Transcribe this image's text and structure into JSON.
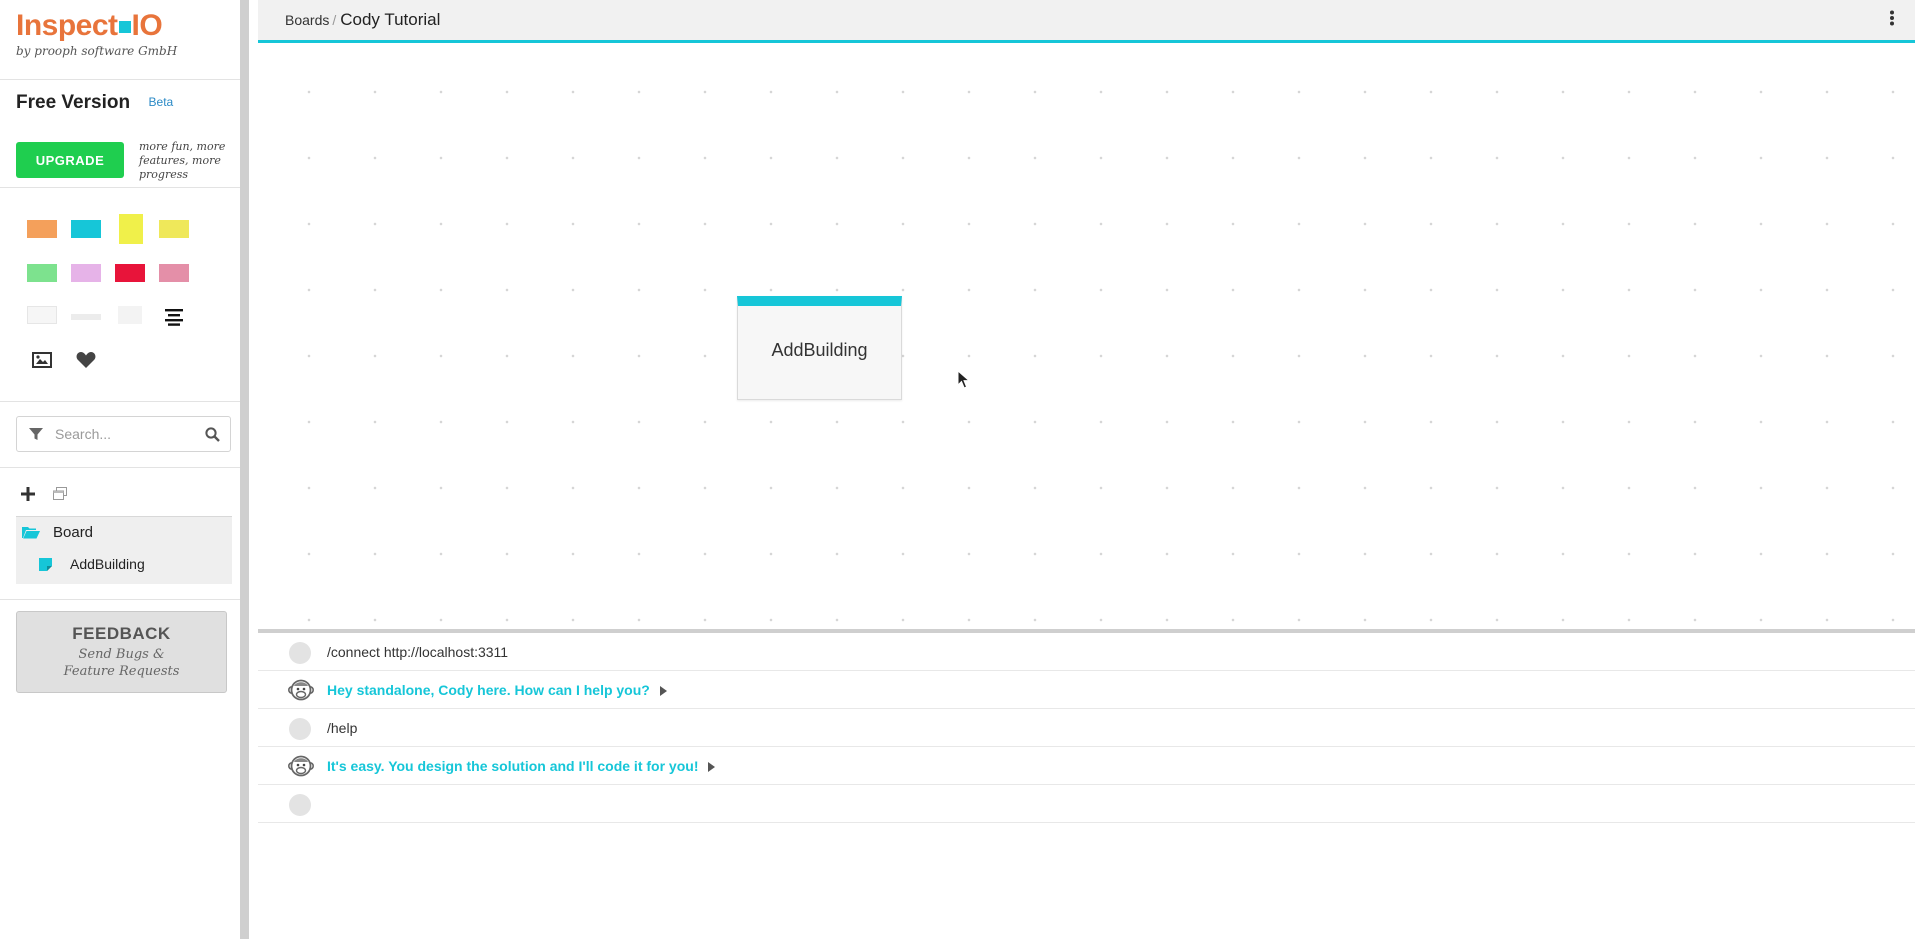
{
  "app": {
    "logo_text_a": "Inspect",
    "logo_text_b": "IO",
    "logo_sub": "by prooph software GmbH"
  },
  "version": {
    "title": "Free Version",
    "badge": "Beta",
    "upgrade_label": "UPGRADE",
    "upgrade_note": "more fun, more features, more progress"
  },
  "palette": {
    "colors": [
      "#f4a05b",
      "#16c6d8",
      "#f0f04a",
      "#efe85a",
      "#7de28e",
      "#e6b3e8",
      "#e8143a",
      "#e48fa8"
    ],
    "icons": [
      "sticky-note-blank-icon",
      "line-icon",
      "frame-icon",
      "text-align-icon",
      "image-icon",
      "heart-icon"
    ]
  },
  "search": {
    "placeholder": "Search..."
  },
  "tree": {
    "root_label": "Board",
    "child_label": "AddBuilding"
  },
  "feedback": {
    "title": "FEEDBACK",
    "subtitle": "Send Bugs & Feature Requests"
  },
  "topbar": {
    "breadcrumb_root": "Boards",
    "separator": "/",
    "board_title": "Cody Tutorial"
  },
  "canvas": {
    "card_label": "AddBuilding",
    "card_color": "#16c6d8"
  },
  "console": {
    "messages": [
      {
        "type": "user",
        "text": "/connect http://localhost:3311"
      },
      {
        "type": "cody",
        "text": "Hey standalone, Cody here. How can I help you?"
      },
      {
        "type": "user",
        "text": "/help"
      },
      {
        "type": "cody",
        "text": "It's easy. You design the solution and I'll code it for you!"
      },
      {
        "type": "user",
        "text": ""
      }
    ]
  }
}
